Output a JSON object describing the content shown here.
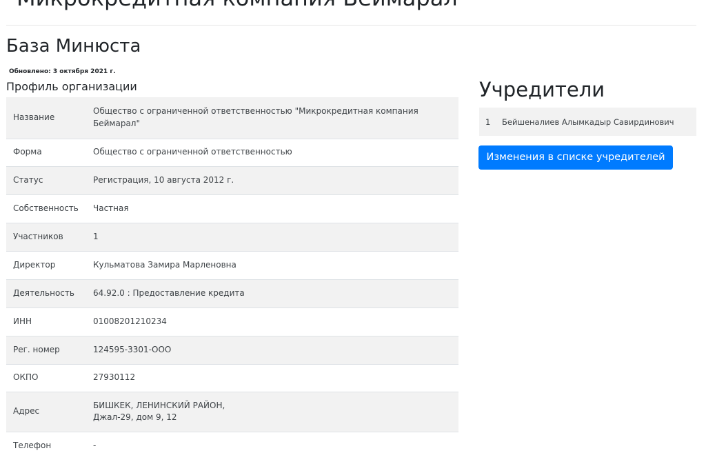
{
  "header": {
    "company_title": "Микрокредитная компания Беймарал"
  },
  "main": {
    "section_title": "База Минюста",
    "updated": "Обновлено: 3 октября 2021 г.",
    "profile_title": "Профиль организации",
    "profile": [
      {
        "label": "Название",
        "value": "Общество с ограниченной ответственностью \"Микрокредитная компания Беймарал\""
      },
      {
        "label": "Форма",
        "value": "Общество с ограниченной ответственностью"
      },
      {
        "label": "Статус",
        "value": "Регистрация, 10 августа 2012 г."
      },
      {
        "label": "Собственность",
        "value": "Частная"
      },
      {
        "label": "Участников",
        "value": "1"
      },
      {
        "label": "Директор",
        "value": "Кульматова Замира Марленовна"
      },
      {
        "label": "Деятельность",
        "value": "64.92.0 : Предоставление кредита"
      },
      {
        "label": "ИНН",
        "value": "01008201210234"
      },
      {
        "label": "Рег. номер",
        "value": "124595-3301-ООО"
      },
      {
        "label": "ОКПО",
        "value": "27930112"
      },
      {
        "label": "Адрес",
        "value": "БИШКЕК, ЛЕНИНСКИЙ РАЙОН,",
        "value2": "Джал-29, дом 9, 12"
      },
      {
        "label": "Телефон",
        "value": "-"
      }
    ]
  },
  "founders": {
    "title": "Учредители",
    "items": [
      {
        "num": "1",
        "name": "Бейшеналиев Алымкадыр Савирдинович"
      }
    ],
    "changes_button": "Изменения в списке учредителей"
  },
  "colors": {
    "accent": "#007bff",
    "stripe": "#f2f2f2"
  }
}
